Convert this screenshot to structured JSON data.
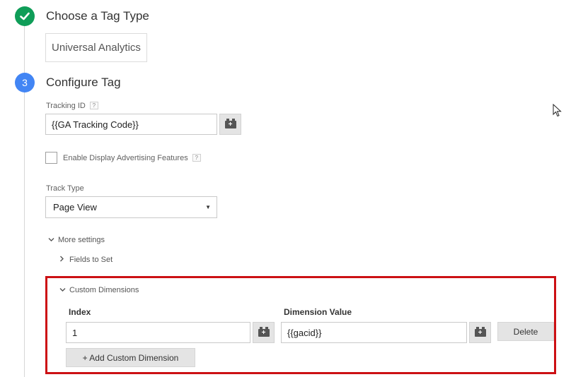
{
  "step1": {
    "title": "Choose a Tag Type",
    "tag_type": "Universal Analytics"
  },
  "step2": {
    "number": "3",
    "title": "Configure Tag"
  },
  "tracking": {
    "label": "Tracking ID",
    "help": "?",
    "value": "{{GA Tracking Code}}"
  },
  "display_ads": {
    "label": "Enable Display Advertising Features",
    "help": "?",
    "checked": false
  },
  "track_type": {
    "label": "Track Type",
    "selected": "Page View"
  },
  "more_settings": {
    "label": "More settings",
    "fields_to_set": "Fields to Set"
  },
  "custom_dimensions": {
    "label": "Custom Dimensions",
    "index_header": "Index",
    "value_header": "Dimension Value",
    "rows": [
      {
        "index": "1",
        "value": "{{gacid}}",
        "delete_label": "Delete"
      }
    ],
    "add_label": "+ Add Custom Dimension"
  },
  "colors": {
    "success": "#0f9d58",
    "step_active": "#4285f4",
    "highlight": "#cc1014"
  }
}
